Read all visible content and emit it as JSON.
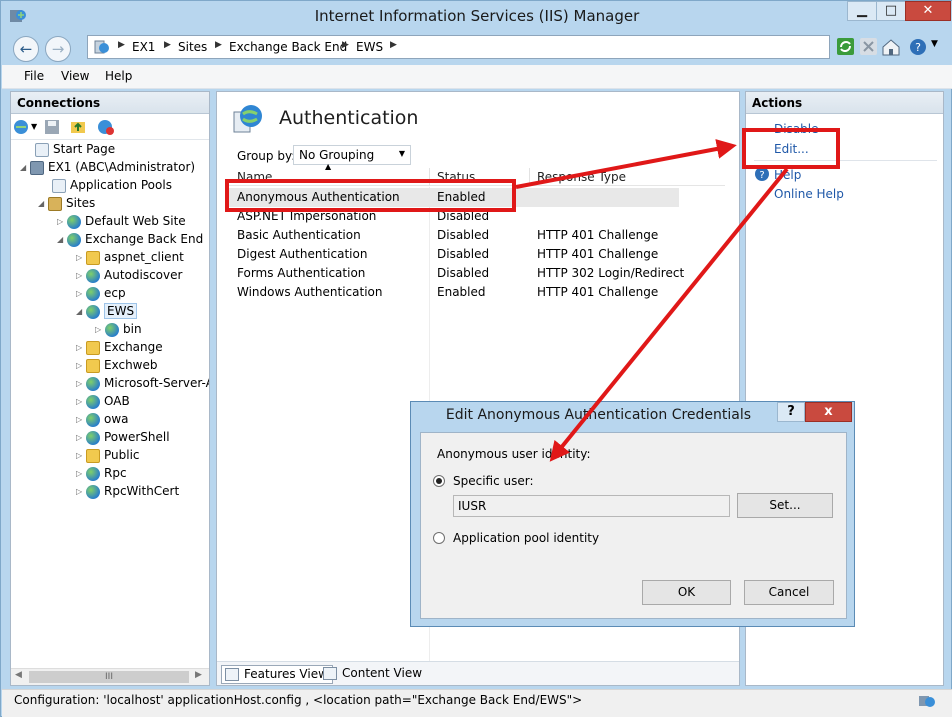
{
  "window": {
    "title": "Internet Information Services (IIS) Manager"
  },
  "address": {
    "crumbs": [
      "EX1",
      "Sites",
      "Exchange Back End",
      "EWS"
    ]
  },
  "menu": {
    "items": [
      "File",
      "View",
      "Help"
    ]
  },
  "connections": {
    "header": "Connections",
    "tree": [
      {
        "label": "Start Page",
        "icon": "start-page-icon"
      },
      {
        "label": "EX1 (ABC\\Administrator)",
        "icon": "server-icon"
      },
      {
        "label": "Application Pools",
        "icon": "app-pools-icon"
      },
      {
        "label": "Sites",
        "icon": "sites-icon"
      },
      {
        "label": "Default Web Site",
        "icon": "globe-icon"
      },
      {
        "label": "Exchange Back End",
        "icon": "globe-icon"
      },
      {
        "label": "aspnet_client",
        "icon": "folder-icon"
      },
      {
        "label": "Autodiscover",
        "icon": "app-globe-icon"
      },
      {
        "label": "ecp",
        "icon": "app-globe-icon"
      },
      {
        "label": "EWS",
        "icon": "app-globe-icon"
      },
      {
        "label": "bin",
        "icon": "app-globe-icon"
      },
      {
        "label": "Exchange",
        "icon": "folder-icon"
      },
      {
        "label": "Exchweb",
        "icon": "folder-icon"
      },
      {
        "label": "Microsoft-Server-A",
        "icon": "app-globe-icon"
      },
      {
        "label": "OAB",
        "icon": "app-globe-icon"
      },
      {
        "label": "owa",
        "icon": "app-globe-icon"
      },
      {
        "label": "PowerShell",
        "icon": "app-globe-icon"
      },
      {
        "label": "Public",
        "icon": "folder-icon"
      },
      {
        "label": "Rpc",
        "icon": "app-globe-icon"
      },
      {
        "label": "RpcWithCert",
        "icon": "app-globe-icon"
      }
    ],
    "hscroll_thumb": "III"
  },
  "main": {
    "title": "Authentication",
    "group_by_label": "Group by:",
    "group_by_value": "No Grouping",
    "columns": [
      "Name",
      "Status",
      "Response Type"
    ],
    "rows": [
      {
        "name": "Anonymous Authentication",
        "status": "Enabled",
        "response": ""
      },
      {
        "name": "ASP.NET Impersonation",
        "status": "Disabled",
        "response": ""
      },
      {
        "name": "Basic Authentication",
        "status": "Disabled",
        "response": "HTTP 401 Challenge"
      },
      {
        "name": "Digest Authentication",
        "status": "Disabled",
        "response": "HTTP 401 Challenge"
      },
      {
        "name": "Forms Authentication",
        "status": "Disabled",
        "response": "HTTP 302 Login/Redirect"
      },
      {
        "name": "Windows Authentication",
        "status": "Enabled",
        "response": "HTTP 401 Challenge"
      }
    ],
    "view_tabs": [
      "Features View",
      "Content View"
    ]
  },
  "actions": {
    "header": "Actions",
    "links": [
      "Disable",
      "Edit...",
      "Help",
      "Online Help"
    ]
  },
  "status_bar": {
    "text": "Configuration: 'localhost' applicationHost.config , <location path=\"Exchange Back End/EWS\">"
  },
  "dialog": {
    "title": "Edit Anonymous Authentication Credentials",
    "help_label": "?",
    "close_label": "x",
    "identity_label": "Anonymous user identity:",
    "specific_user_label": "Specific user:",
    "user_value": "IUSR",
    "set_button": "Set...",
    "app_pool_label": "Application pool identity",
    "ok_button": "OK",
    "cancel_button": "Cancel"
  },
  "colors": {
    "annotation_red": "#e01818",
    "titlebar": "#b8d6ee",
    "link_blue": "#1f58a8"
  }
}
